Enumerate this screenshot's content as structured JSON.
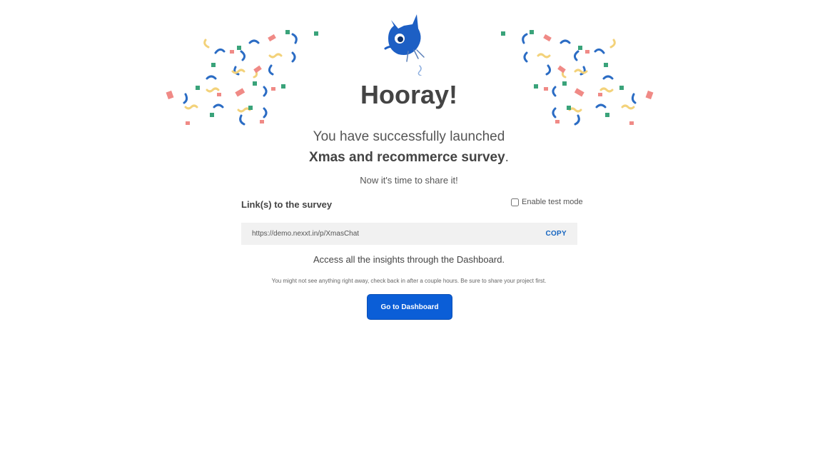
{
  "hero": {
    "title": "Hooray!",
    "launched_text": "You have successfully launched",
    "survey_name": "Xmas and recommerce survey",
    "period": ".",
    "share_prompt": "Now it's time to share it!"
  },
  "links": {
    "label": "Link(s) to the survey",
    "test_mode_label": "Enable test mode",
    "test_mode_checked": false,
    "url": "https://demo.nexxt.in/p/XmasChat",
    "copy_label": "COPY"
  },
  "dashboard": {
    "insights_text": "Access all the insights through the Dashboard.",
    "hint_text": "You might not see anything right away, check back in after a couple hours. Be sure to share your project first.",
    "button_label": "Go to Dashboard"
  },
  "colors": {
    "accent": "#0b5ed7",
    "copy": "#1565c0",
    "confetti_blue": "#2b6cc4",
    "confetti_red": "#f08a86",
    "confetti_yellow": "#f3d27a",
    "confetti_green": "#3aa37a"
  },
  "icons": {
    "mascot": "blue-bird-mascot-icon",
    "confetti": "confetti-icon"
  }
}
